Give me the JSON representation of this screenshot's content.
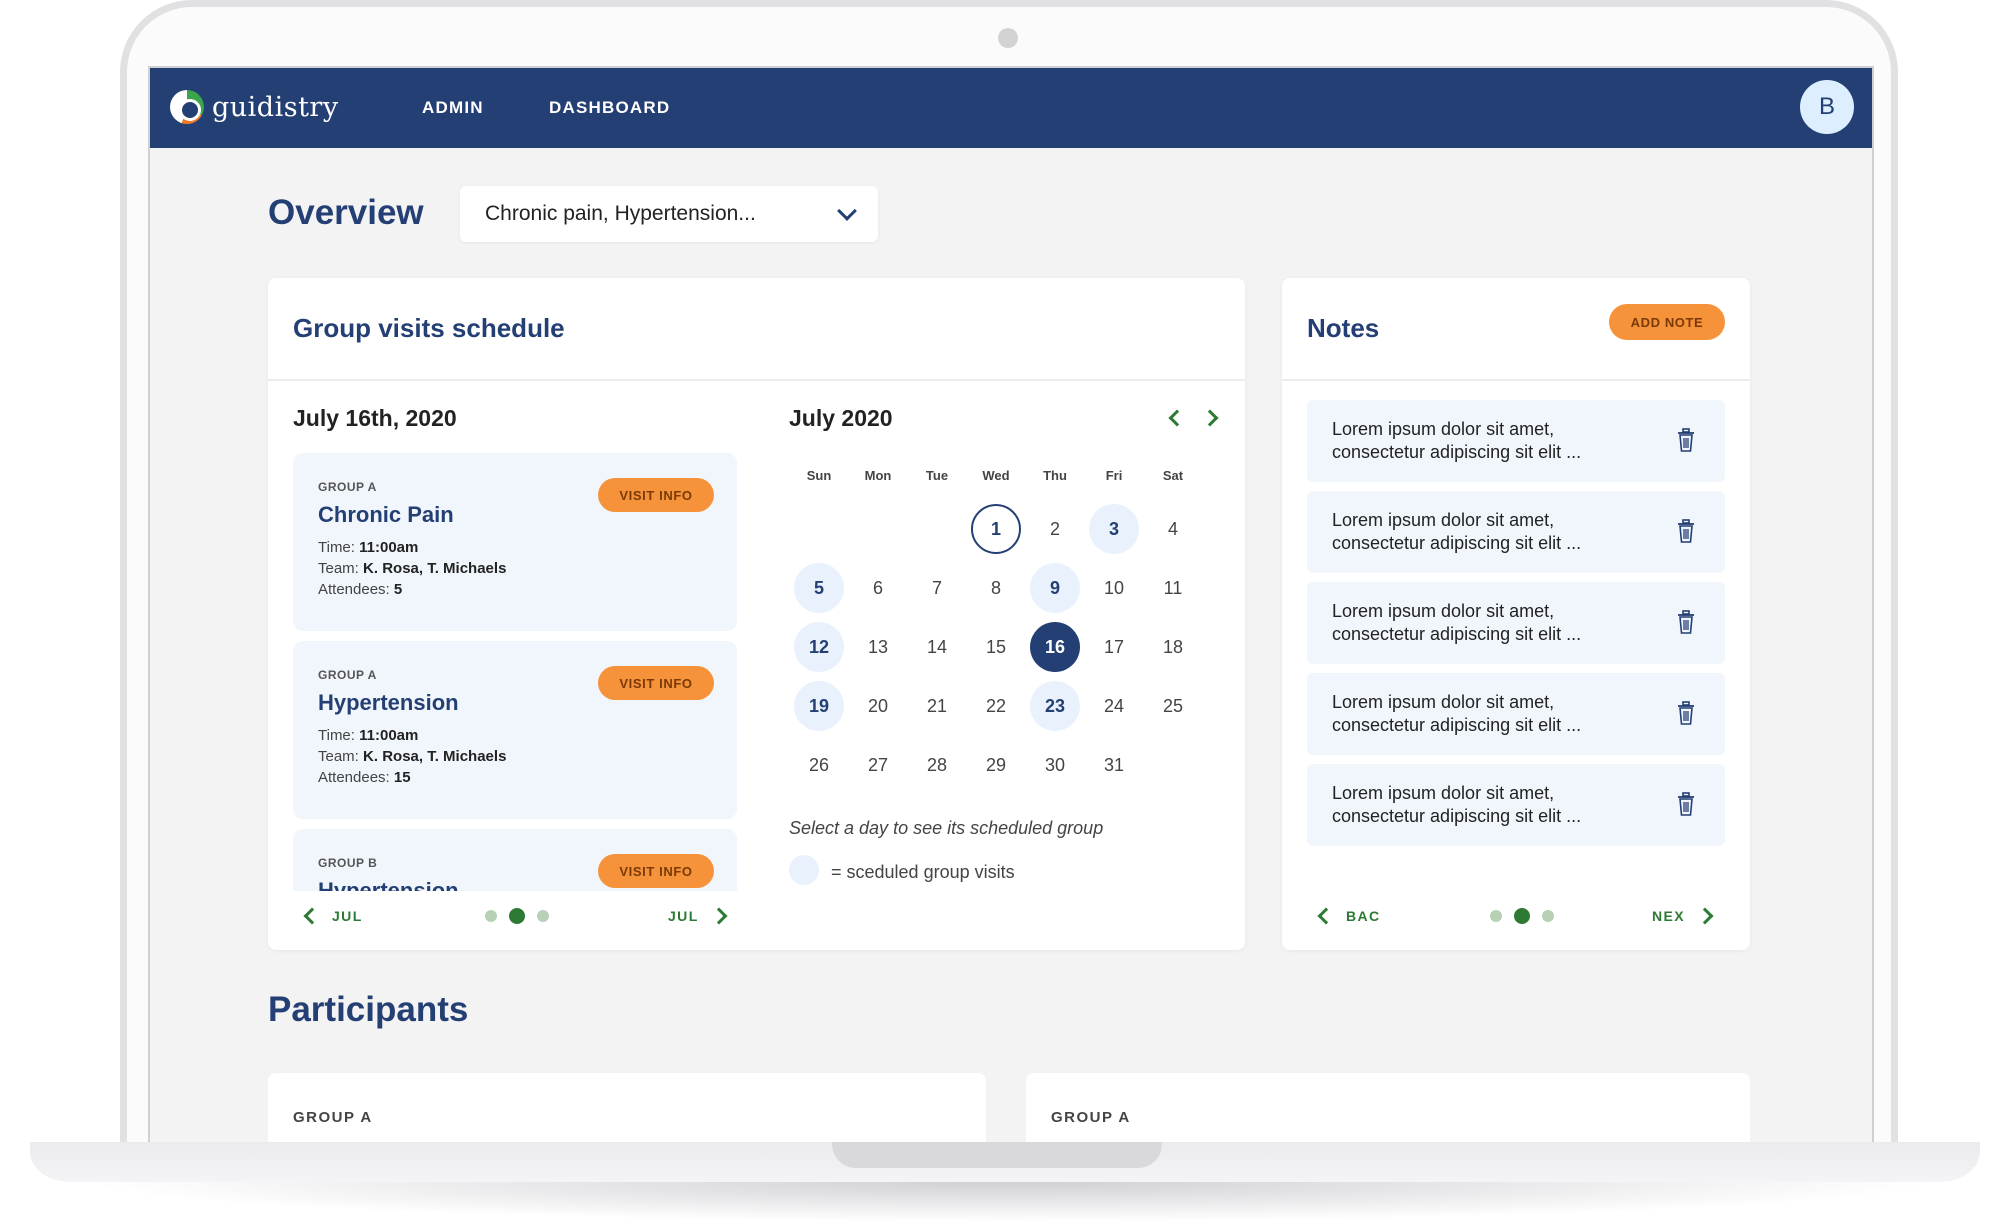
{
  "app": {
    "logo_text": "guidistry",
    "avatar_initial": "B"
  },
  "nav": {
    "items": [
      "ADMIN",
      "DASHBOARD"
    ]
  },
  "overview": {
    "title": "Overview",
    "filter_value": "Chronic pain, Hypertension..."
  },
  "schedule": {
    "title": "Group visits schedule",
    "selected_date": "July 16th, 2020",
    "visits": [
      {
        "group": "GROUP A",
        "name": "Chronic Pain",
        "time_label": "Time:",
        "time": "11:00am",
        "team_label": "Team:",
        "team": "K. Rosa, T. Michaels",
        "attendees_label": "Attendees:",
        "attendees": "5",
        "button": "VISIT INFO"
      },
      {
        "group": "GROUP A",
        "name": "Hypertension",
        "time_label": "Time:",
        "time": "11:00am",
        "team_label": "Team:",
        "team": "K. Rosa, T. Michaels",
        "attendees_label": "Attendees:",
        "attendees": "15",
        "button": "VISIT INFO"
      },
      {
        "group": "GROUP B",
        "name": "Hypertension",
        "button": "VISIT INFO"
      }
    ],
    "pager": {
      "prev": "JUL",
      "next": "JUL",
      "pages": 3,
      "active_page": 2
    }
  },
  "calendar": {
    "month_label": "July 2020",
    "weekdays": [
      "Sun",
      "Mon",
      "Tue",
      "Wed",
      "Thu",
      "Fri",
      "Sat"
    ],
    "first_weekday_index": 3,
    "days_in_month": 31,
    "today": 1,
    "selected": 16,
    "scheduled_days": [
      3,
      5,
      9,
      12,
      19,
      23
    ],
    "hint": "Select a day to see its scheduled group",
    "legend": "= sceduled group visits",
    "colors": {
      "navy": "#243f73",
      "scheduled": "#e9f2fc"
    }
  },
  "notes": {
    "title": "Notes",
    "add_button": "ADD NOTE",
    "items": [
      {
        "line1": "Lorem ipsum dolor sit amet,",
        "line2": "consectetur adipiscing sit elit ..."
      },
      {
        "line1": "Lorem ipsum dolor sit amet,",
        "line2": "consectetur adipiscing sit elit ..."
      },
      {
        "line1": "Lorem ipsum dolor sit amet,",
        "line2": "consectetur adipiscing sit elit ..."
      },
      {
        "line1": "Lorem ipsum dolor sit amet,",
        "line2": "consectetur adipiscing sit elit ..."
      },
      {
        "line1": "Lorem ipsum dolor sit amet,",
        "line2": "consectetur adipiscing sit elit ..."
      }
    ],
    "pager": {
      "prev": "BAC",
      "next": "NEX",
      "pages": 3,
      "active_page": 2
    }
  },
  "participants": {
    "title": "Participants",
    "cards": [
      {
        "group": "GROUP A"
      },
      {
        "group": "GROUP A"
      }
    ]
  },
  "colors": {
    "navy": "#243f73",
    "orange": "#f6923a",
    "green": "#2c7a34"
  }
}
